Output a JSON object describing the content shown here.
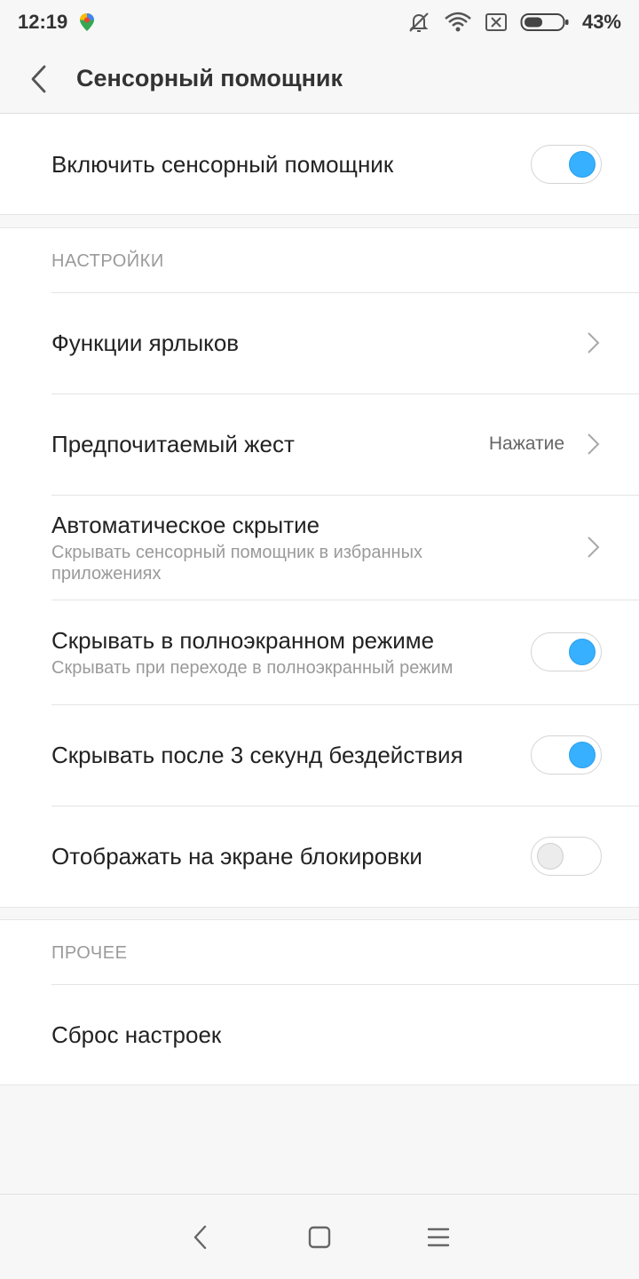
{
  "status_bar": {
    "time": "12:19",
    "battery_percent": "43%",
    "battery_level": 0.43,
    "icons": [
      "maps-icon",
      "mute-icon",
      "wifi-icon",
      "sim-error-icon",
      "battery-icon"
    ]
  },
  "app_bar": {
    "title": "Сенсорный помощник",
    "back_icon": "chevron-left-icon"
  },
  "main_toggle": {
    "label": "Включить сенсорный помощник",
    "enabled": true
  },
  "settings_section": {
    "header": "НАСТРОЙКИ",
    "items": [
      {
        "title": "Функции ярлыков",
        "type": "link"
      },
      {
        "title": "Предпочитаемый жест",
        "value": "Нажатие",
        "type": "link"
      },
      {
        "title": "Автоматическое скрытие",
        "subtitle": "Скрывать сенсорный помощник в избранных приложениях",
        "type": "link"
      },
      {
        "title": "Скрывать в полноэкранном режиме",
        "subtitle": "Скрывать при переходе в полноэкранный режим",
        "type": "toggle",
        "enabled": true
      },
      {
        "title": "Скрывать после 3 секунд бездействия",
        "type": "toggle",
        "enabled": true
      },
      {
        "title": "Отображать на экране блокировки",
        "type": "toggle",
        "enabled": false
      }
    ]
  },
  "other_section": {
    "header": "ПРОЧЕЕ",
    "items": [
      {
        "title": "Сброс настроек",
        "type": "link"
      }
    ]
  },
  "colors": {
    "accent": "#37b0ff",
    "background": "#f7f7f7",
    "card": "#ffffff",
    "text_primary": "#222222",
    "text_secondary": "#9a9a9a"
  },
  "nav_bar": {
    "buttons": [
      "nav-back-icon",
      "nav-home-icon",
      "nav-menu-icon"
    ]
  }
}
